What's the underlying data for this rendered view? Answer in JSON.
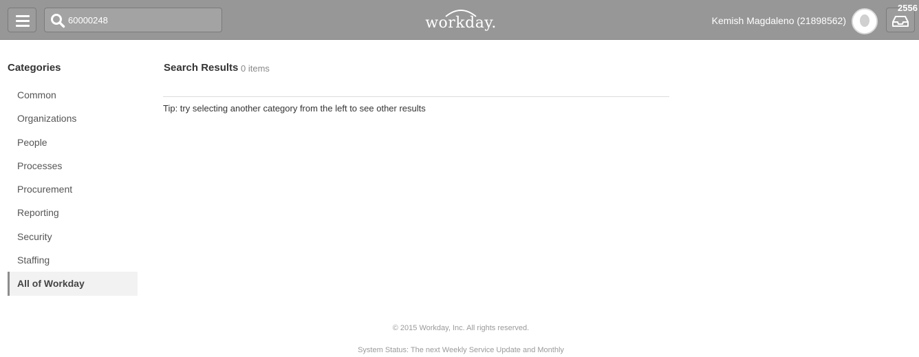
{
  "header": {
    "search": {
      "value": "60000248",
      "icon": "search-icon"
    },
    "logo_text": "workday.",
    "user": {
      "name": "Kemish Magdaleno (21898562)"
    },
    "inbox": {
      "badge_count": "2556",
      "icon": "inbox-icon"
    },
    "menu_icon": "hamburger-menu-icon",
    "colors": {
      "header_bg": "#979797",
      "text": "#ffffff"
    }
  },
  "sidebar": {
    "title": "Categories",
    "items": [
      {
        "label": "Common"
      },
      {
        "label": "Organizations"
      },
      {
        "label": "People"
      },
      {
        "label": "Processes"
      },
      {
        "label": "Procurement"
      },
      {
        "label": "Reporting"
      },
      {
        "label": "Security"
      },
      {
        "label": "Staffing"
      },
      {
        "label": "All of Workday",
        "selected": true
      }
    ]
  },
  "main": {
    "title": "Search Results",
    "count": "0 items",
    "tip": "Tip: try selecting another category from the left to see other results"
  },
  "footer": {
    "copyright": "© 2015 Workday, Inc. All rights reserved.",
    "status": "System Status: The next Weekly Service Update and Monthly"
  }
}
